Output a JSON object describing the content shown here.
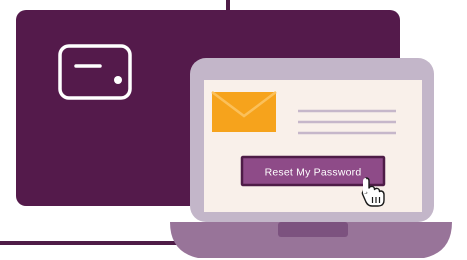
{
  "illustration": {
    "button": {
      "label": "Reset My Password"
    },
    "icons": {
      "card": "credit-card-icon",
      "envelope": "envelope-icon",
      "cursor": "hand-pointer-icon"
    },
    "colors": {
      "card_panel": "#541a4b",
      "button_fill": "#8e4b88",
      "button_border": "#4e1c47",
      "laptop_frame": "#c3b6c9",
      "laptop_screen": "#f9f0ea",
      "laptop_base": "#987499",
      "envelope": "#f6a31c",
      "text_lines": "#c6b7ca",
      "outline": "#4e1c47",
      "white": "#ffffff"
    }
  }
}
